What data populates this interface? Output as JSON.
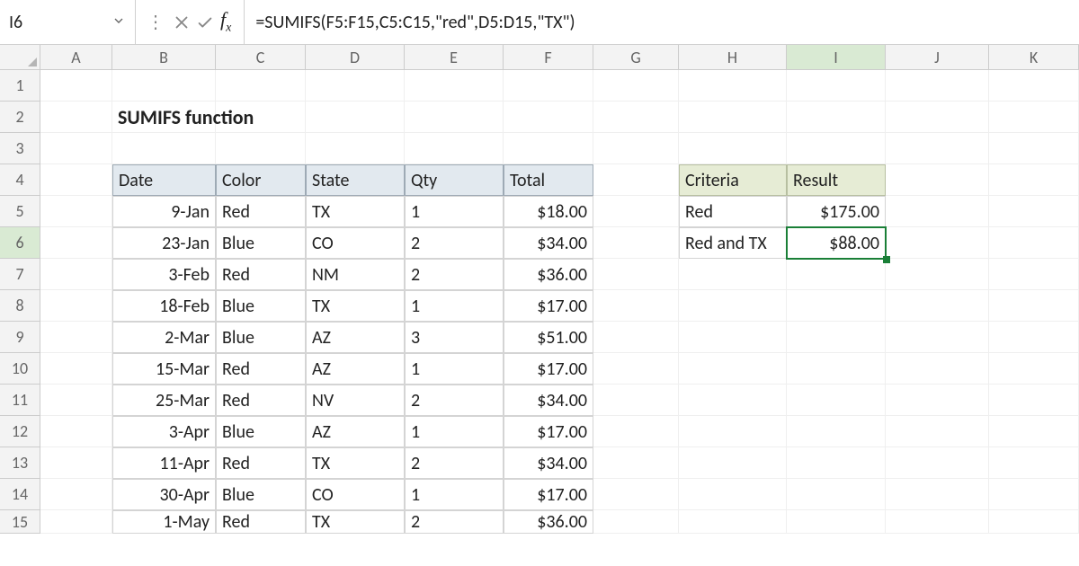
{
  "formula_bar": {
    "cell_ref": "I6",
    "formula": "=SUMIFS(F5:F15,C5:C15,\"red\",D5:D15,\"TX\")"
  },
  "columns": [
    "A",
    "B",
    "C",
    "D",
    "E",
    "F",
    "G",
    "H",
    "I",
    "J",
    "K"
  ],
  "rows": [
    "1",
    "2",
    "3",
    "4",
    "5",
    "6",
    "7",
    "8",
    "9",
    "10",
    "11",
    "12",
    "13",
    "14",
    "15"
  ],
  "title": "SUMIFS function",
  "main_table": {
    "headers": {
      "date": "Date",
      "color": "Color",
      "state": "State",
      "qty": "Qty",
      "total": "Total"
    },
    "rows": [
      {
        "date": "9-Jan",
        "color": "Red",
        "state": "TX",
        "qty": "1",
        "total": "$18.00"
      },
      {
        "date": "23-Jan",
        "color": "Blue",
        "state": "CO",
        "qty": "2",
        "total": "$34.00"
      },
      {
        "date": "3-Feb",
        "color": "Red",
        "state": "NM",
        "qty": "2",
        "total": "$36.00"
      },
      {
        "date": "18-Feb",
        "color": "Blue",
        "state": "TX",
        "qty": "1",
        "total": "$17.00"
      },
      {
        "date": "2-Mar",
        "color": "Blue",
        "state": "AZ",
        "qty": "3",
        "total": "$51.00"
      },
      {
        "date": "15-Mar",
        "color": "Red",
        "state": "AZ",
        "qty": "1",
        "total": "$17.00"
      },
      {
        "date": "25-Mar",
        "color": "Red",
        "state": "NV",
        "qty": "2",
        "total": "$34.00"
      },
      {
        "date": "3-Apr",
        "color": "Blue",
        "state": "AZ",
        "qty": "1",
        "total": "$17.00"
      },
      {
        "date": "11-Apr",
        "color": "Red",
        "state": "TX",
        "qty": "2",
        "total": "$34.00"
      },
      {
        "date": "30-Apr",
        "color": "Blue",
        "state": "CO",
        "qty": "1",
        "total": "$17.00"
      },
      {
        "date": "1-May",
        "color": "Red",
        "state": "TX",
        "qty": "2",
        "total": "$36.00"
      }
    ]
  },
  "criteria_table": {
    "headers": {
      "criteria": "Criteria",
      "result": "Result"
    },
    "rows": [
      {
        "criteria": "Red",
        "result": "$175.00"
      },
      {
        "criteria": "Red and TX",
        "result": "$88.00"
      }
    ]
  },
  "active_cell": "I6"
}
